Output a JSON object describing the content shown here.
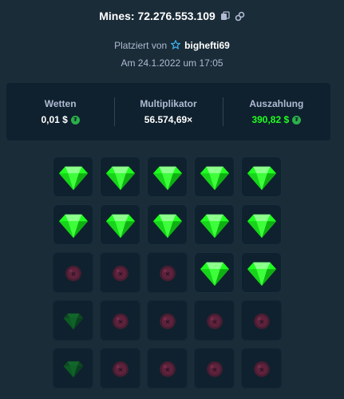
{
  "header": {
    "title": "Mines: 72.276.553.109",
    "copy_icon": "copy-icon",
    "link_icon": "link-icon"
  },
  "placed": {
    "prefix": "Platziert von",
    "user_icon": "star-icon",
    "username": "bighefti69"
  },
  "date": "Am 24.1.2022 um 17:05",
  "stats": {
    "bet_label": "Wetten",
    "bet_value": "0,01 $",
    "multiplier_label": "Multiplikator",
    "multiplier_value": "56.574,69×",
    "payout_label": "Auszahlung",
    "payout_value": "390,82 $",
    "payout_color": "#1fff20",
    "currency_icon": "tether-coin-icon"
  },
  "colors": {
    "background": "#1a2c38",
    "panel": "#0f212e",
    "gem": "#1fff20",
    "mine": "#8a1d3a"
  },
  "board": [
    [
      "gem",
      "gem",
      "gem",
      "gem",
      "gem"
    ],
    [
      "gem",
      "gem",
      "gem",
      "gem",
      "gem"
    ],
    [
      "mine-dim",
      "mine-dim",
      "mine-dim",
      "gem",
      "gem"
    ],
    [
      "gem-dim",
      "mine-dim",
      "mine-dim",
      "mine-dim",
      "mine-dim"
    ],
    [
      "gem-dim",
      "mine-dim",
      "mine-dim",
      "mine-dim",
      "mine-dim"
    ]
  ]
}
